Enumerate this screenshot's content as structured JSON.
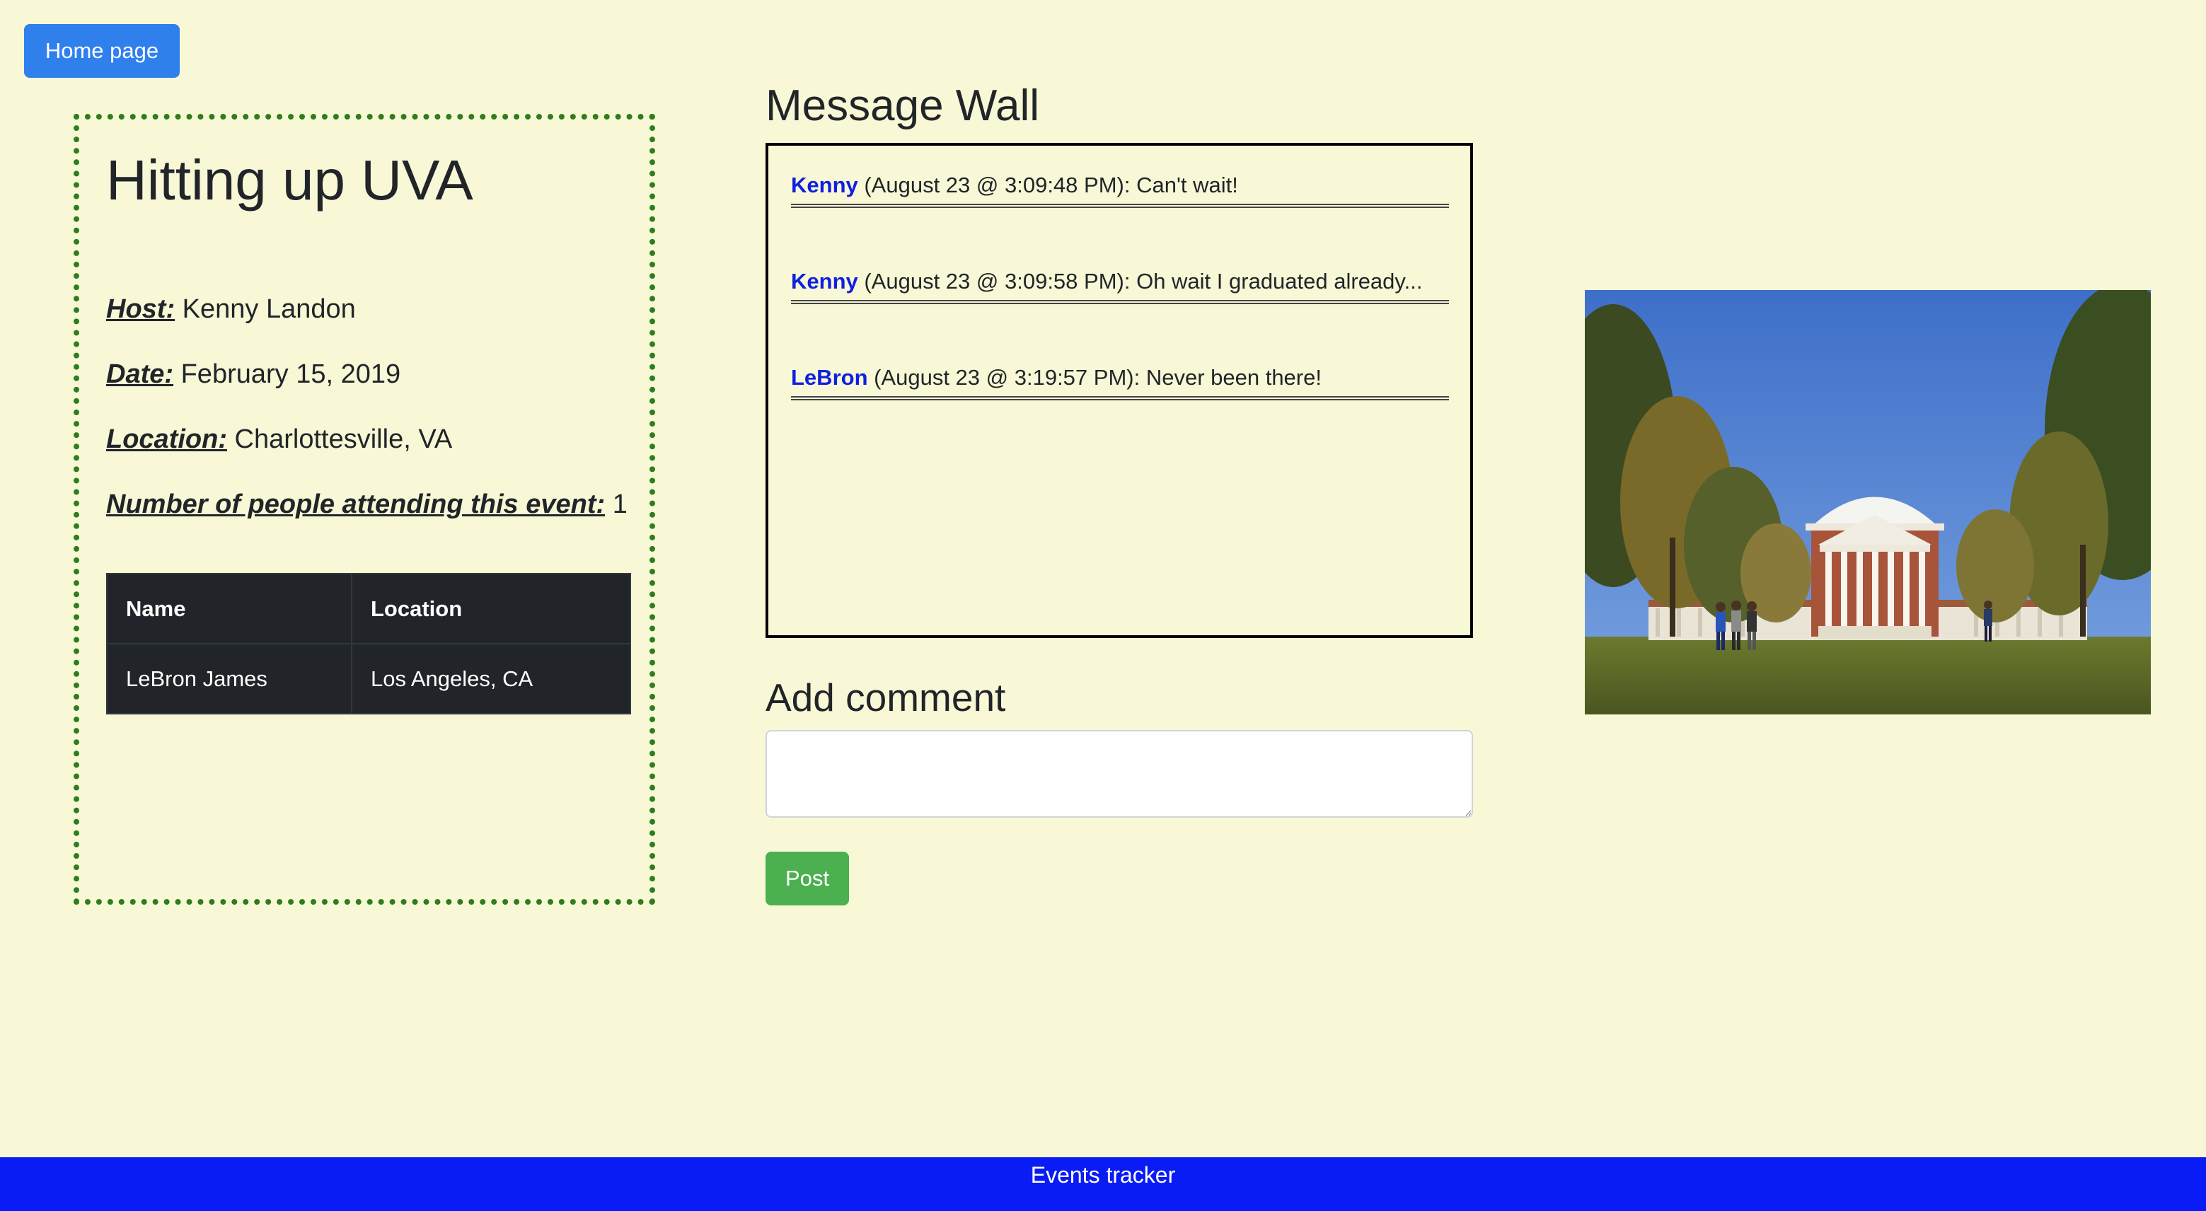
{
  "nav": {
    "home_label": "Home page"
  },
  "event": {
    "title": "Hitting up UVA",
    "host_label": "Host:",
    "host_value": "Kenny Landon",
    "date_label": "Date:",
    "date_value": "February 15, 2019",
    "location_label": "Location:",
    "location_value": "Charlottesville, VA",
    "attendance_label": "Number of people attending this event:",
    "attendance_value": "1",
    "table": {
      "headers": [
        "Name",
        "Location"
      ],
      "rows": [
        [
          "LeBron James",
          "Los Angeles, CA"
        ]
      ]
    }
  },
  "wall": {
    "title": "Message Wall",
    "messages": [
      {
        "author": "Kenny",
        "text": " (August 23 @ 3:09:48 PM): Can't wait!"
      },
      {
        "author": "Kenny",
        "text": " (August 23 @ 3:09:58 PM): Oh wait I graduated already..."
      },
      {
        "author": "LeBron",
        "text": " (August 23 @ 3:19:57 PM): Never been there!"
      }
    ]
  },
  "comment": {
    "title": "Add comment",
    "value": "",
    "placeholder": "",
    "post_label": "Post"
  },
  "footer": {
    "text": "Events tracker"
  },
  "colors": {
    "background": "#f8f8d6",
    "primary_button": "#2f80ed",
    "post_button": "#4caf50",
    "footer": "#0a1cf5",
    "author_link": "#1020e0",
    "card_border": "#2e7d1e"
  }
}
